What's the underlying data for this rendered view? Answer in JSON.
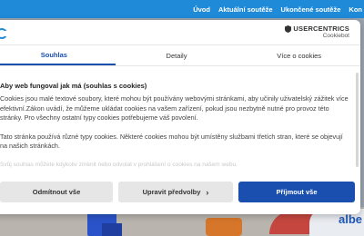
{
  "site": {
    "nav_links": [
      "Úvod",
      "Aktuální soutěže",
      "Ukončené soutěže",
      "Kon"
    ],
    "brand_fragment": "albe"
  },
  "dialog": {
    "logo": {
      "name": "USERCENTRICS",
      "sub": "Cookiebot"
    },
    "tabs": [
      {
        "label": "Souhlas",
        "active": true
      },
      {
        "label": "Detaily",
        "active": false
      },
      {
        "label": "Více o cookies",
        "active": false
      }
    ],
    "heading": "Aby web fungoval jak má (souhlas s cookies)",
    "paragraphs": [
      "Cookies jsou malé textové soubory, které mohou být používány webovými stránkami, aby učinily uživatelský zážitek více efektivní.Zákon uvádí, že můžeme ukládat cookies na vašem zařízení, pokud jsou nezbytně nutné pro provoz této stránky. Pro všechny ostatní typy cookies potřebujeme váš povolení.",
      "Tato stránka používá různé typy cookies. Některé cookies mohou být umístěny službami třetích stran, které se objevují na našich stránkách."
    ],
    "faded_text": "Svůj souhlas můžete kdykoliv změnit nebo odvolat v prohlášení o cookies na našem webu.",
    "buttons": {
      "reject": "Odmítnout vše",
      "customize": "Upravit předvolby",
      "customize_icon": "chevron-right-icon",
      "accept": "Příjmout vše"
    }
  },
  "colors": {
    "nav_bg": "#1f8ad8",
    "primary": "#1a4fb0",
    "button_grey": "#e6e6e6"
  }
}
